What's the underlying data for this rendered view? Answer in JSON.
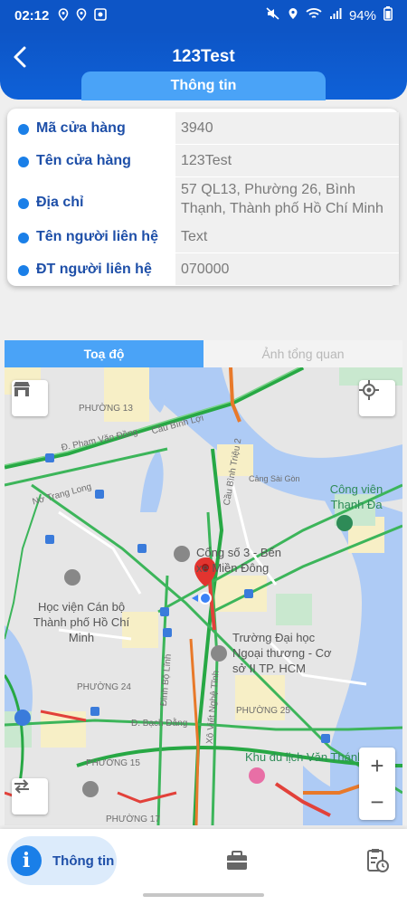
{
  "status_bar": {
    "time": "02:12",
    "battery": "94%"
  },
  "header": {
    "title": "123Test",
    "tab_label": "Thông tin"
  },
  "store_info": [
    {
      "label": "Mã cửa hàng",
      "value": "3940"
    },
    {
      "label": "Tên cửa hàng",
      "value": "123Test"
    },
    {
      "label": "Địa chỉ",
      "value": "57 QL13, Phường 26, Bình Thạnh, Thành phố Hồ Chí Minh"
    },
    {
      "label": "Tên người liên hệ",
      "value": "Text"
    },
    {
      "label": "ĐT người liên hệ",
      "value": "070000"
    }
  ],
  "map_tabs": {
    "active": "Toạ độ",
    "inactive": "Ảnh tổng quan"
  },
  "map": {
    "labels": {
      "phuong13": "PHƯỜNG 13",
      "cau_binh_loi": "Cầu Bình Lợi",
      "pham_van_dong": "Đ. Phạm Văn Đồng",
      "no_trang_long": "Nơ Trang Long",
      "cau_binh_trieu": "Cầu Bình Triệu 2",
      "cong_son": "Cảng Sài Gòn",
      "park": "Công viên Thanh Đa",
      "cong_so3": "Cổng số 3 - Bến xe Miền Đông",
      "hoc_vien": "Học viện Cán bộ Thành phố Hồ Chí Minh",
      "truong_dai_hoc": "Trường Đại học Ngoại thương - Cơ sở II TP. HCM",
      "phuong24": "PHƯỜNG 24",
      "phuong25": "PHƯỜNG 25",
      "phuong15": "PHƯỜNG 15",
      "phuong17": "PHƯỜNG 17",
      "dinh_bo_linh": "Đinh Bộ Lĩnh",
      "xo_viet": "Xô Viết Nghệ Tĩnh",
      "bach_dang": "Đ. Bạch Đằng",
      "khu_du_lich": "Khu du lịch Văn Thánh"
    },
    "zoom_in": "+",
    "zoom_out": "−"
  },
  "bottom_nav": {
    "home_label": "Thông tin",
    "info_glyph": "i"
  },
  "colors": {
    "primary": "#0d55c6",
    "accent": "#4aa3f7",
    "label": "#1e4fa8"
  }
}
